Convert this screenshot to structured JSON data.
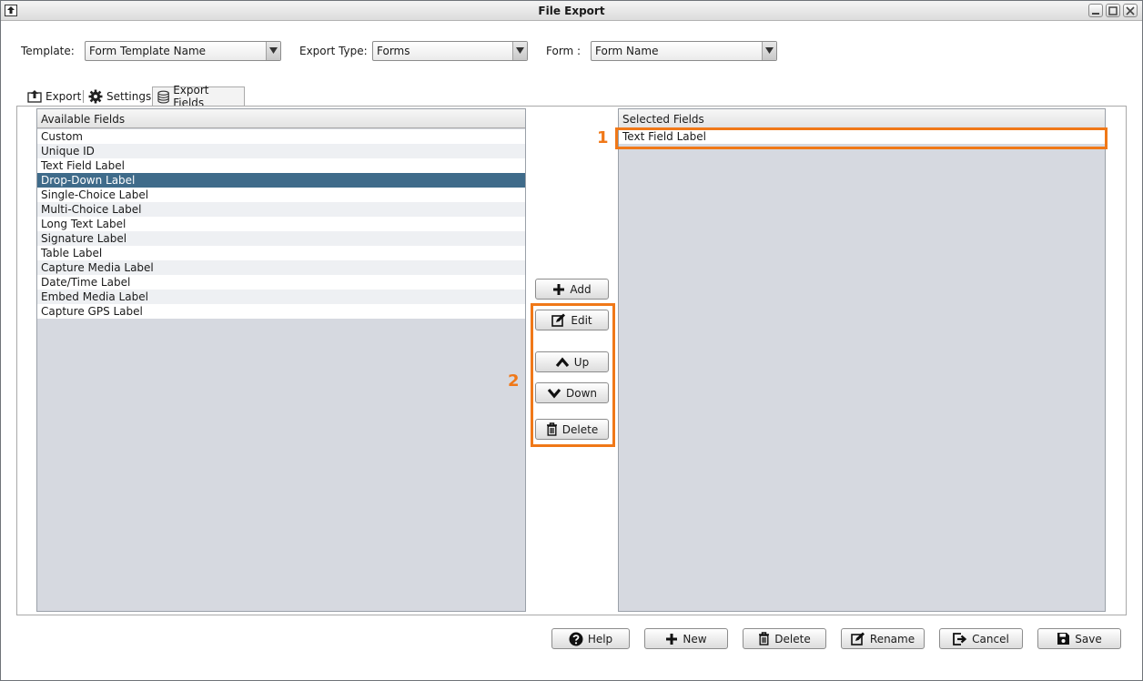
{
  "window": {
    "title": "File Export"
  },
  "topbar": {
    "template_label": "Template:",
    "template_value": "Form Template Name",
    "export_type_label": "Export Type:",
    "export_type_value": "Forms",
    "form_label": "Form :",
    "form_value": "Form Name"
  },
  "tabs": [
    {
      "label": "Export",
      "icon": "export-icon"
    },
    {
      "label": "Settings",
      "icon": "gear-icon"
    },
    {
      "label": "Export Fields",
      "icon": "database-icon"
    }
  ],
  "available": {
    "header": "Available Fields",
    "items": [
      "Custom",
      "Unique ID",
      "Text Field Label",
      "Drop-Down Label",
      "Single-Choice Label",
      "Multi-Choice Label",
      "Long Text Label",
      "Signature Label",
      "Table Label",
      "Capture Media Label",
      "Date/Time Label",
      "Embed Media Label",
      "Capture GPS Label"
    ],
    "selected_index": 3
  },
  "selected": {
    "header": "Selected Fields",
    "items": [
      "Text Field Label"
    ]
  },
  "middle_buttons": {
    "add": "Add",
    "edit": "Edit",
    "up": "Up",
    "down": "Down",
    "delete": "Delete"
  },
  "callouts": {
    "one": "1",
    "two": "2"
  },
  "footer": {
    "help": "Help",
    "new": "New",
    "delete": "Delete",
    "rename": "Rename",
    "cancel": "Cancel",
    "save": "Save"
  },
  "colors": {
    "highlight": "#f07818",
    "selection": "#3f6b8a",
    "list_bg": "#d6d9e0"
  }
}
